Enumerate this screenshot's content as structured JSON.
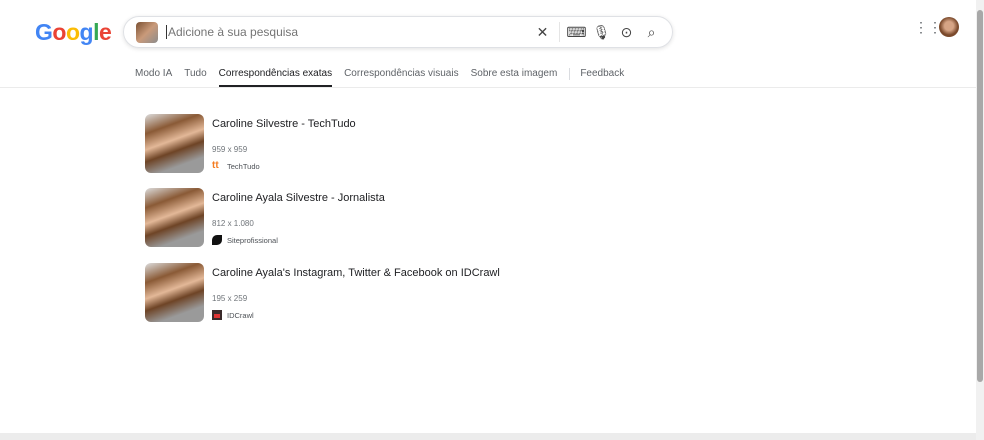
{
  "logo": "Google",
  "search": {
    "placeholder": "Adicione à sua pesquisa"
  },
  "tabs": [
    "Modo IA",
    "Tudo",
    "Correspondências exatas",
    "Correspondências visuais",
    "Sobre esta imagem",
    "Feedback"
  ],
  "results": [
    {
      "title": "Caroline Silvestre - TechTudo",
      "dims": "959 x 959",
      "source": "TechTudo"
    },
    {
      "title": "Caroline Ayala Silvestre - Jornalista",
      "dims": "812 x 1.080",
      "source": "Siteprofissional"
    },
    {
      "title": "Caroline Ayala's Instagram, Twitter & Facebook on IDCrawl",
      "dims": "195 x 259",
      "source": "IDCrawl"
    }
  ]
}
